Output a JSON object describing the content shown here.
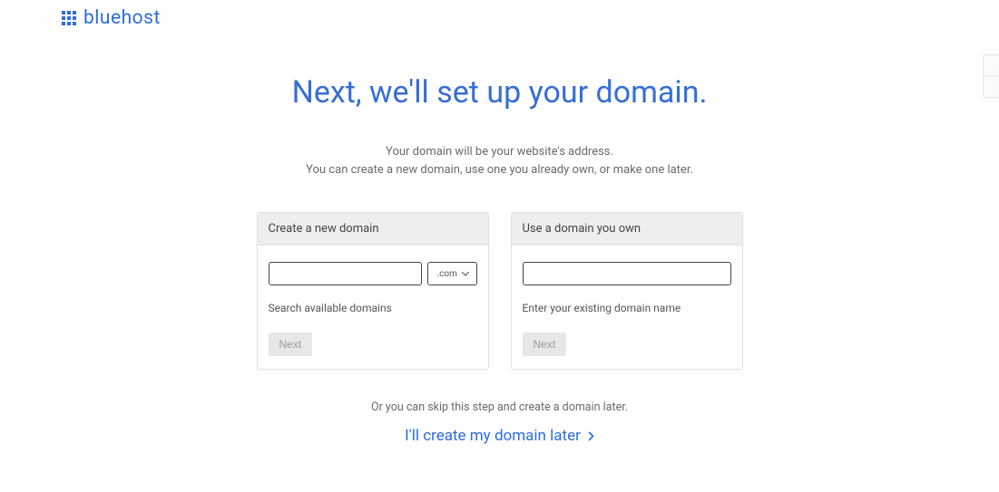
{
  "logo": {
    "text": "bluehost"
  },
  "heading": "Next, we'll set up your domain.",
  "subhead_line1": "Your domain will be your website's address.",
  "subhead_line2": "You can create a new domain, use one you already own, or make one later.",
  "cards": {
    "create": {
      "title": "Create a new domain",
      "tld_selected": ".com",
      "helper": "Search available domains",
      "button": "Next"
    },
    "own": {
      "title": "Use a domain you own",
      "helper": "Enter your existing domain name",
      "button": "Next"
    }
  },
  "skip": {
    "lead": "Or you can skip this step and create a domain later.",
    "link": "I'll create my domain later"
  }
}
